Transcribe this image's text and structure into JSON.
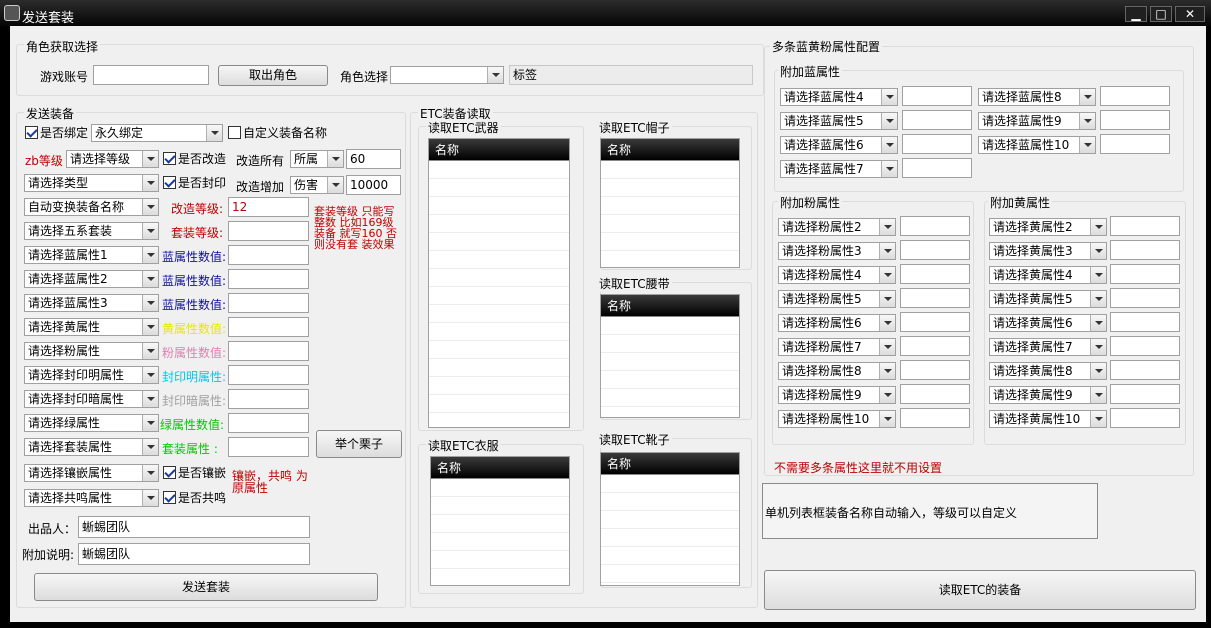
{
  "window": {
    "title": "发送套装",
    "min": "▁",
    "max": "□",
    "close": "✕"
  },
  "role": {
    "group": "角色获取选择",
    "account_label": "游戏账号",
    "account_value": "",
    "fetch_button": "取出角色",
    "role_label": "角色选择",
    "role_value": "",
    "tag": "标签"
  },
  "send": {
    "group": "发送装备",
    "bind_label": "是否绑定",
    "bind_value": "永久绑定",
    "custom_name_label": "自定义装备名称",
    "zb_label": "zb等级",
    "level_select": "请选择等级",
    "modify_label": "是否改造",
    "modify_all_label": "改造所有",
    "modify_all_value": "所属",
    "modify_value": "60",
    "type_select": "请选择类型",
    "seal_label": "是否封印",
    "modify_add_label": "改造增加",
    "modify_add_value": "伤害",
    "modify_add_num": "10000",
    "auto_name": "自动变换装备名称",
    "mod_level_label": "改造等级:",
    "mod_level_value": "12",
    "five_set": "请选择五系套装",
    "set_level_label": "套装等级:",
    "blue1": "请选择蓝属性1",
    "blue1_val": "蓝属性数值:",
    "blue2": "请选择蓝属性2",
    "blue2_val": "蓝属性数值:",
    "blue3": "请选择蓝属性3",
    "blue3_val": "蓝属性数值:",
    "yellow": "请选择黄属性",
    "yellow_val": "黄属性数值:",
    "pink": "请选择粉属性",
    "pink_val": "粉属性数值:",
    "seal_light": "请选择封印明属性",
    "seal_light_val": "封印明属性:",
    "seal_dark": "请选择封印暗属性",
    "seal_dark_val": "封印暗属性:",
    "green": "请选择绿属性",
    "green_val": "绿属性数值:",
    "set_attr": "请选择套装属性",
    "set_attr_val": "套装属性 :",
    "inlay": "请选择镶嵌属性",
    "inlay_chk": "是否镶嵌",
    "resonance": "请选择共鸣属性",
    "resonance_chk": "是否共鸣",
    "note_set": "套装等级 只能写整数 比如169级装备 就写160 否则没有套 装效果",
    "note_inlay": "镶嵌，共鸣 为原属性",
    "example_button": "举个栗子",
    "producer_label": "出品人：",
    "producer_value": "蜥蜴团队",
    "note_label": "附加说明:",
    "note_value": "蜥蜴团队",
    "send_button": "发送套装"
  },
  "etc": {
    "group": "ETC装备读取",
    "weapon": "读取ETC武器",
    "hat": "读取ETC帽子",
    "belt": "读取ETC腰带",
    "clothes": "读取ETC衣服",
    "shoes": "读取ETC靴子",
    "col": "名称"
  },
  "multi": {
    "group": "多条蓝黄粉属性配置",
    "blue_group": "附加蓝属性",
    "blue": [
      "请选择蓝属性4",
      "请选择蓝属性8",
      "请选择蓝属性5",
      "请选择蓝属性9",
      "请选择蓝属性6",
      "请选择蓝属性10",
      "请选择蓝属性7"
    ],
    "pink_group": "附加粉属性",
    "pink": [
      "请选择粉属性2",
      "请选择粉属性3",
      "请选择粉属性4",
      "请选择粉属性5",
      "请选择粉属性6",
      "请选择粉属性7",
      "请选择粉属性8",
      "请选择粉属性9",
      "请选择粉属性10"
    ],
    "yellow_group": "附加黄属性",
    "yellow": [
      "请选择黄属性2",
      "请选择黄属性3",
      "请选择黄属性4",
      "请选择黄属性5",
      "请选择黄属性6",
      "请选择黄属性7",
      "请选择黄属性8",
      "请选择黄属性9",
      "请选择黄属性10"
    ],
    "hint": "不需要多条属性这里就不用设置",
    "info": "单机列表框装备名称自动输入，等级可以自定义",
    "read_button": "读取ETC的装备"
  }
}
